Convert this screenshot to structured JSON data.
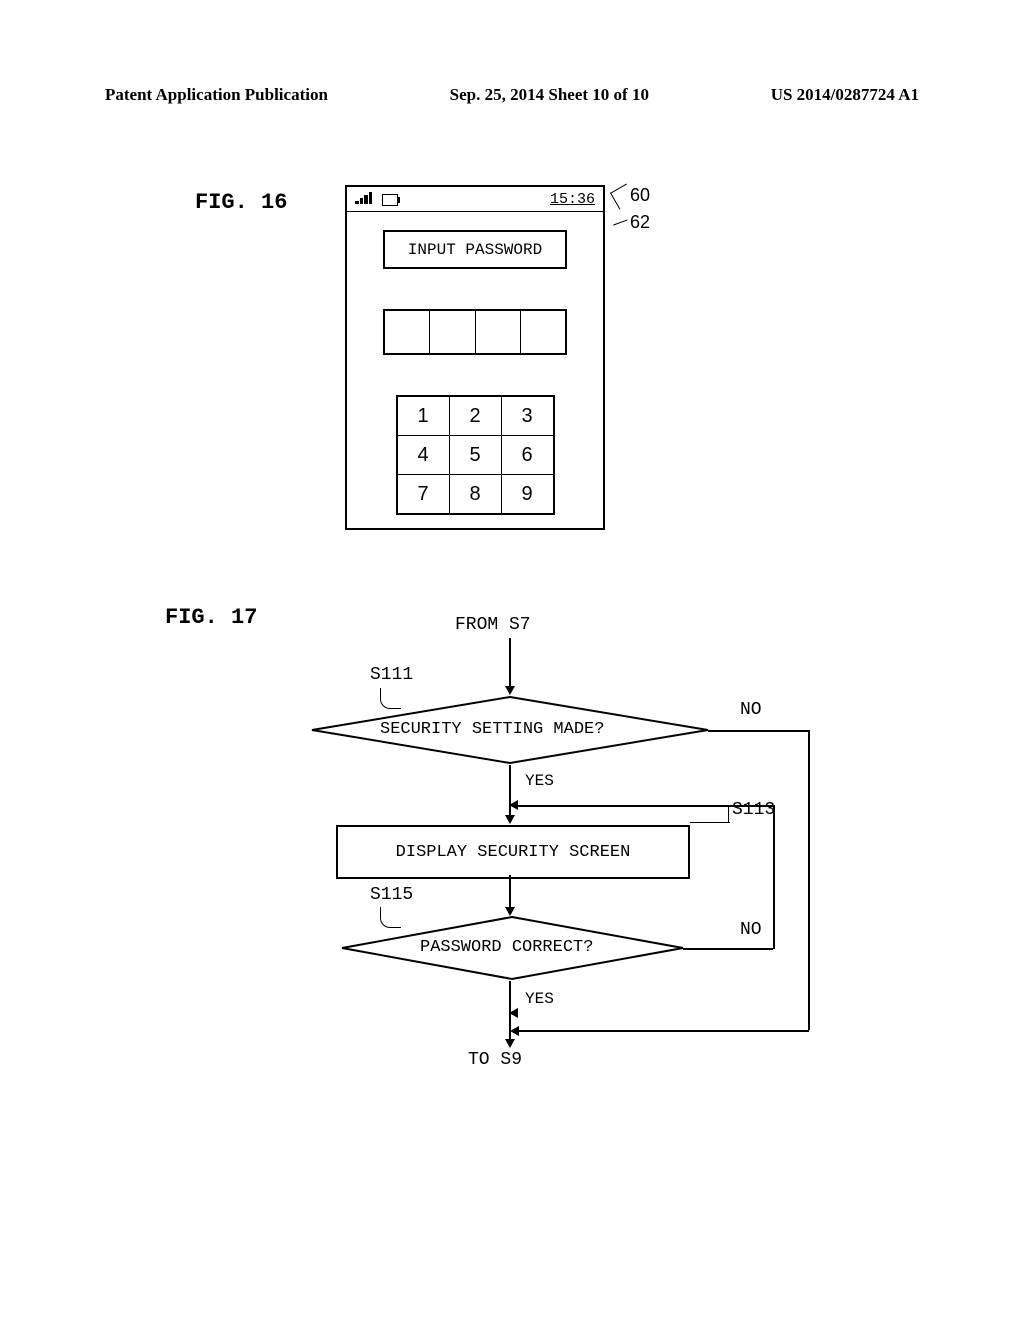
{
  "header": {
    "left": "Patent Application Publication",
    "center": "Sep. 25, 2014  Sheet 10 of 10",
    "right": "US 2014/0287724 A1"
  },
  "fig16": {
    "label": "FIG. 16",
    "time": "15:36",
    "input_password": "INPUT PASSWORD",
    "keypad": [
      [
        "1",
        "2",
        "3"
      ],
      [
        "4",
        "5",
        "6"
      ],
      [
        "7",
        "8",
        "9"
      ]
    ],
    "callout_60": "60",
    "callout_62": "62"
  },
  "fig17": {
    "label": "FIG. 17",
    "from": "FROM S7",
    "s111": "S111",
    "diamond1": "SECURITY SETTING MADE?",
    "no1": "NO",
    "yes1": "YES",
    "s113": "S113",
    "box": "DISPLAY SECURITY SCREEN",
    "s115": "S115",
    "diamond2": "PASSWORD CORRECT?",
    "no2": "NO",
    "yes2": "YES",
    "to": "TO S9"
  }
}
